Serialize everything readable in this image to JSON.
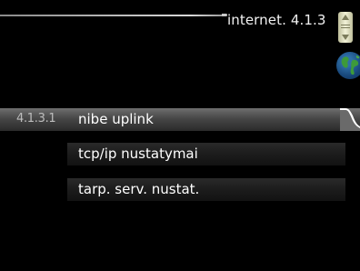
{
  "header": {
    "title": "internet. 4.1.3"
  },
  "icons": {
    "scroll": "scroll-indicator-icon",
    "globe": "globe-icon"
  },
  "menu": {
    "items": [
      {
        "number": "4.1.3.1",
        "label": "nibe uplink",
        "selected": true
      },
      {
        "number": "",
        "label": "tcp/ip nustatymai",
        "selected": false
      },
      {
        "number": "",
        "label": "tarp. serv. nustat.",
        "selected": false
      }
    ]
  }
}
